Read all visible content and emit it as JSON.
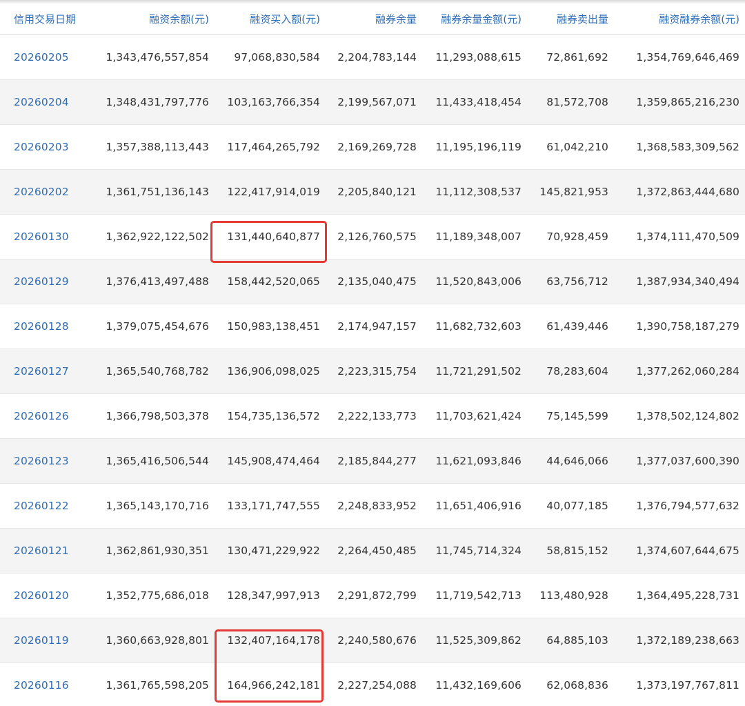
{
  "table": {
    "headers": [
      "信用交易日期",
      "融资余额(元)",
      "融资买入额(元)",
      "融券余量",
      "融券余量金额(元)",
      "融券卖出量",
      "融资融券余额(元)"
    ],
    "rows": [
      {
        "date": "20260205",
        "values": [
          "1,343,476,557,854",
          "97,068,830,584",
          "2,204,783,144",
          "11,293,088,615",
          "72,861,692",
          "1,354,769,646,469"
        ]
      },
      {
        "date": "20260204",
        "values": [
          "1,348,431,797,776",
          "103,163,766,354",
          "2,199,567,071",
          "11,433,418,454",
          "81,572,708",
          "1,359,865,216,230"
        ]
      },
      {
        "date": "20260203",
        "values": [
          "1,357,388,113,443",
          "117,464,265,792",
          "2,169,269,728",
          "11,195,196,119",
          "61,042,210",
          "1,368,583,309,562"
        ]
      },
      {
        "date": "20260202",
        "values": [
          "1,361,751,136,143",
          "122,417,914,019",
          "2,205,840,121",
          "11,112,308,537",
          "145,821,953",
          "1,372,863,444,680"
        ]
      },
      {
        "date": "20260130",
        "values": [
          "1,362,922,122,502",
          "131,440,640,877",
          "2,126,760,575",
          "11,189,348,007",
          "70,928,459",
          "1,374,111,470,509"
        ]
      },
      {
        "date": "20260129",
        "values": [
          "1,376,413,497,488",
          "158,442,520,065",
          "2,135,040,475",
          "11,520,843,006",
          "63,756,712",
          "1,387,934,340,494"
        ]
      },
      {
        "date": "20260128",
        "values": [
          "1,379,075,454,676",
          "150,983,138,451",
          "2,174,947,157",
          "11,682,732,603",
          "61,439,446",
          "1,390,758,187,279"
        ]
      },
      {
        "date": "20260127",
        "values": [
          "1,365,540,768,782",
          "136,906,098,025",
          "2,223,315,754",
          "11,721,291,502",
          "78,283,604",
          "1,377,262,060,284"
        ]
      },
      {
        "date": "20260126",
        "values": [
          "1,366,798,503,378",
          "154,735,136,572",
          "2,222,133,773",
          "11,703,621,424",
          "75,145,599",
          "1,378,502,124,802"
        ]
      },
      {
        "date": "20260123",
        "values": [
          "1,365,416,506,544",
          "145,908,474,464",
          "2,185,844,277",
          "11,621,093,846",
          "44,646,066",
          "1,377,037,600,390"
        ]
      },
      {
        "date": "20260122",
        "values": [
          "1,365,143,170,716",
          "133,171,747,555",
          "2,248,833,952",
          "11,651,406,916",
          "40,077,185",
          "1,376,794,577,632"
        ]
      },
      {
        "date": "20260121",
        "values": [
          "1,362,861,930,351",
          "130,471,229,922",
          "2,264,450,485",
          "11,745,714,324",
          "58,815,152",
          "1,374,607,644,675"
        ]
      },
      {
        "date": "20260120",
        "values": [
          "1,352,775,686,018",
          "128,347,997,913",
          "2,291,872,799",
          "11,719,542,713",
          "113,480,928",
          "1,364,495,228,731"
        ]
      },
      {
        "date": "20260119",
        "values": [
          "1,360,663,928,801",
          "132,407,164,178",
          "2,240,580,676",
          "11,525,309,862",
          "64,885,103",
          "1,372,189,238,663"
        ]
      },
      {
        "date": "20260116",
        "values": [
          "1,361,765,598,205",
          "164,966,242,181",
          "2,227,254,088",
          "11,432,169,606",
          "62,068,836",
          "1,373,197,767,811"
        ]
      }
    ]
  },
  "colors": {
    "header_text": "#2e6db4",
    "date_link": "#2e6db4",
    "cell_text": "#333333",
    "stripe_bg": "#f4f4f4",
    "highlight_border": "#e53935"
  }
}
